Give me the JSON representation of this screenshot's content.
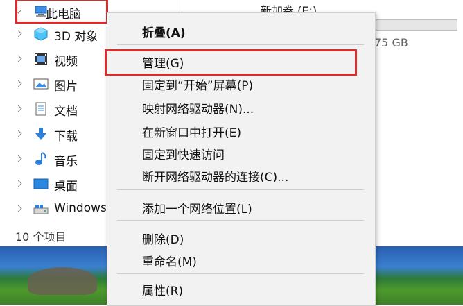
{
  "nav": {
    "items": [
      {
        "label": "此电脑",
        "icon": "computer-icon"
      },
      {
        "label": "3D 对象",
        "icon": "3d-objects-icon"
      },
      {
        "label": "视频",
        "icon": "video-icon"
      },
      {
        "label": "图片",
        "icon": "pictures-icon"
      },
      {
        "label": "文档",
        "icon": "documents-icon"
      },
      {
        "label": "下载",
        "icon": "download-icon"
      },
      {
        "label": "音乐",
        "icon": "music-icon"
      },
      {
        "label": "桌面",
        "icon": "desktop-icon"
      },
      {
        "label": "Windows",
        "icon": "drive-icon"
      }
    ]
  },
  "status": {
    "item_count": "10 个项目"
  },
  "drive": {
    "label": "新加卷 (E:)",
    "size_text": "75 GB"
  },
  "context_menu": {
    "items": [
      {
        "label": "折叠(A)"
      },
      {
        "label": "管理(G)"
      },
      {
        "label": "固定到“开始”屏幕(P)"
      },
      {
        "label": "映射网络驱动器(N)..."
      },
      {
        "label": "在新窗口中打开(E)"
      },
      {
        "label": "固定到快速访问"
      },
      {
        "label": "断开网络驱动器的连接(C)..."
      },
      {
        "label": "添加一个网络位置(L)"
      },
      {
        "label": "删除(D)"
      },
      {
        "label": "重命名(M)"
      },
      {
        "label": "属性(R)"
      }
    ]
  },
  "colors": {
    "highlight_border": "#e02a2a",
    "menu_bg": "#f2f2f2"
  }
}
